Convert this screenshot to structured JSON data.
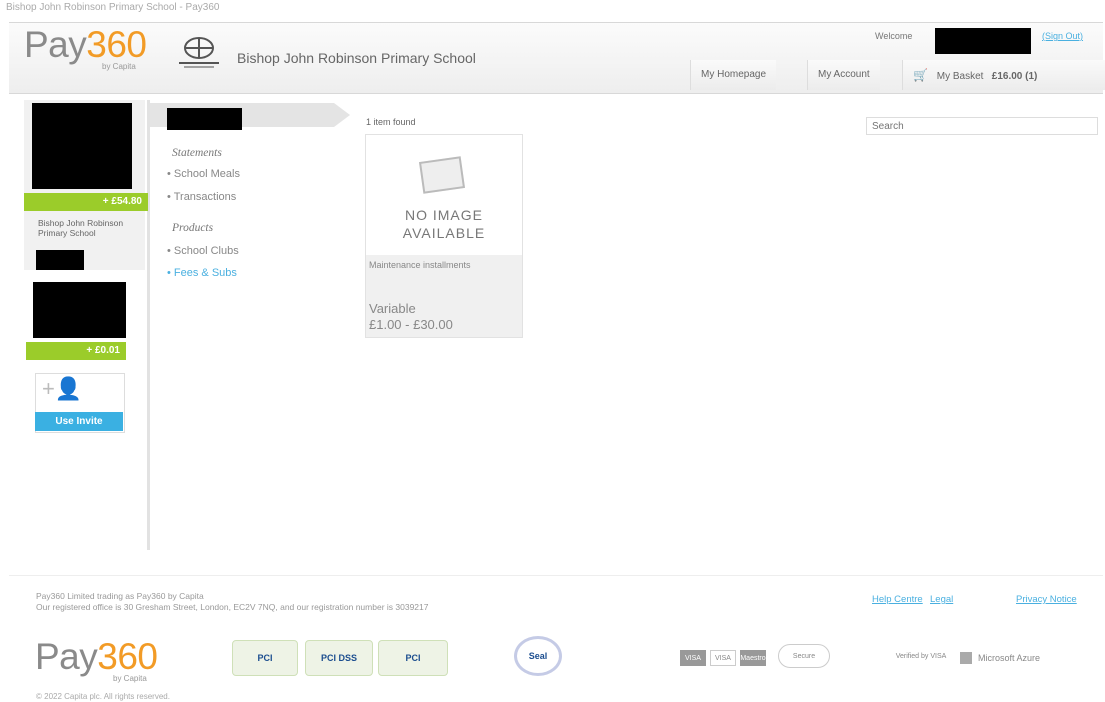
{
  "topbar": {
    "text": "Bishop John Robinson Primary School - Pay360"
  },
  "header": {
    "logo_pay": "Pay",
    "logo_360": "360",
    "logo_sub": "by Capita",
    "school_name": "Bishop John Robinson Primary School",
    "welcome": "Welcome",
    "sign_out": "(Sign Out)",
    "nav": {
      "homepage": "My Homepage",
      "account": "My Account",
      "basket": "My Basket",
      "basket_total": "£16.00 (1)"
    }
  },
  "sidebar": {
    "accounts": [
      {
        "balance": "+ £54.80",
        "school": "Bishop John Robinson Primary School"
      },
      {
        "balance": "+ £0.01"
      }
    ],
    "invite_label": "Use Invite"
  },
  "menu": {
    "statements_heading": "Statements",
    "statements": [
      "School Meals",
      "Transactions"
    ],
    "products_heading": "Products",
    "products": [
      "School Clubs",
      "Fees & Subs"
    ],
    "active_item": "Fees & Subs"
  },
  "results": {
    "count_text": "1 item found",
    "items": [
      {
        "image_text_1": "NO IMAGE",
        "image_text_2": "AVAILABLE",
        "title": "Maintenance installments",
        "price_type": "Variable",
        "price_range": "£1.00 - £30.00"
      }
    ]
  },
  "search": {
    "placeholder": "Search"
  },
  "footer": {
    "line1": "Pay360 Limited trading as Pay360 by Capita",
    "line2": "Our registered office is 30 Gresham Street, London, EC2V 7NQ, and our registration number is 3039217",
    "links": [
      "Help Centre",
      "Legal",
      "Privacy Notice"
    ],
    "logo_pay": "Pay",
    "logo_360": "360",
    "logo_sub": "by Capita",
    "badges": [
      "PCI",
      "PCI DSS",
      "PCI",
      "Seal"
    ],
    "payment_icons": [
      "VISA",
      "VISA",
      "Maestro",
      "Secure",
      "Verified by VISA",
      "Microsoft Azure"
    ],
    "copyright": "© 2022 Capita plc. All rights reserved."
  },
  "colors": {
    "accent_orange": "#f29b26",
    "balance_green": "#9bcc2a",
    "invite_blue": "#3ab0e2",
    "link_blue": "#4ab0e0"
  }
}
